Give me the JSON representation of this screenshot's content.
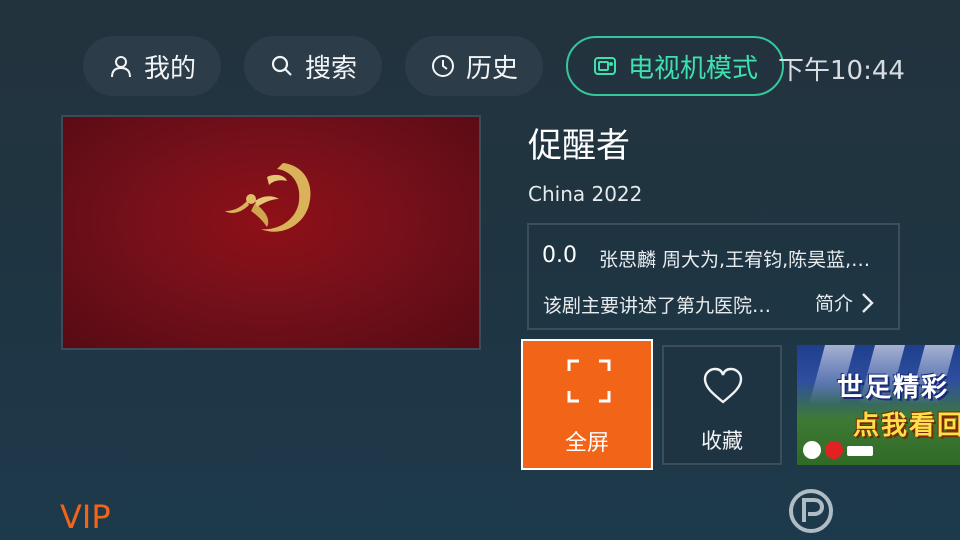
{
  "nav": {
    "mine": {
      "label": "我的",
      "icon": "user-icon"
    },
    "search": {
      "label": "搜索",
      "icon": "search-icon"
    },
    "history": {
      "label": "历史",
      "icon": "clock-icon"
    },
    "tv_mode": {
      "label": "电视机模式",
      "icon": "tv-icon"
    }
  },
  "status": {
    "time": "下午10:44"
  },
  "player": {
    "logo_icon": "golden-dancer-logo"
  },
  "show": {
    "title": "促醒者",
    "meta": "China 2022",
    "rating": "0.0",
    "cast": "张思麟 周大为,王宥钧,陈昊蓝,潘曜",
    "synopsis": "该剧主要讲述了第九医院神经外科",
    "intro_label": "简介"
  },
  "actions": {
    "fullscreen": {
      "label": "全屏",
      "icon": "fullscreen-icon"
    },
    "favorite": {
      "label": "收藏",
      "icon": "heart-icon"
    }
  },
  "promo": {
    "line1": "世足精彩",
    "line2": "点我看回"
  },
  "vip_label": "VIP",
  "colors": {
    "accent_green": "#35c79b",
    "accent_orange": "#f26418",
    "background": "#1f3441"
  }
}
